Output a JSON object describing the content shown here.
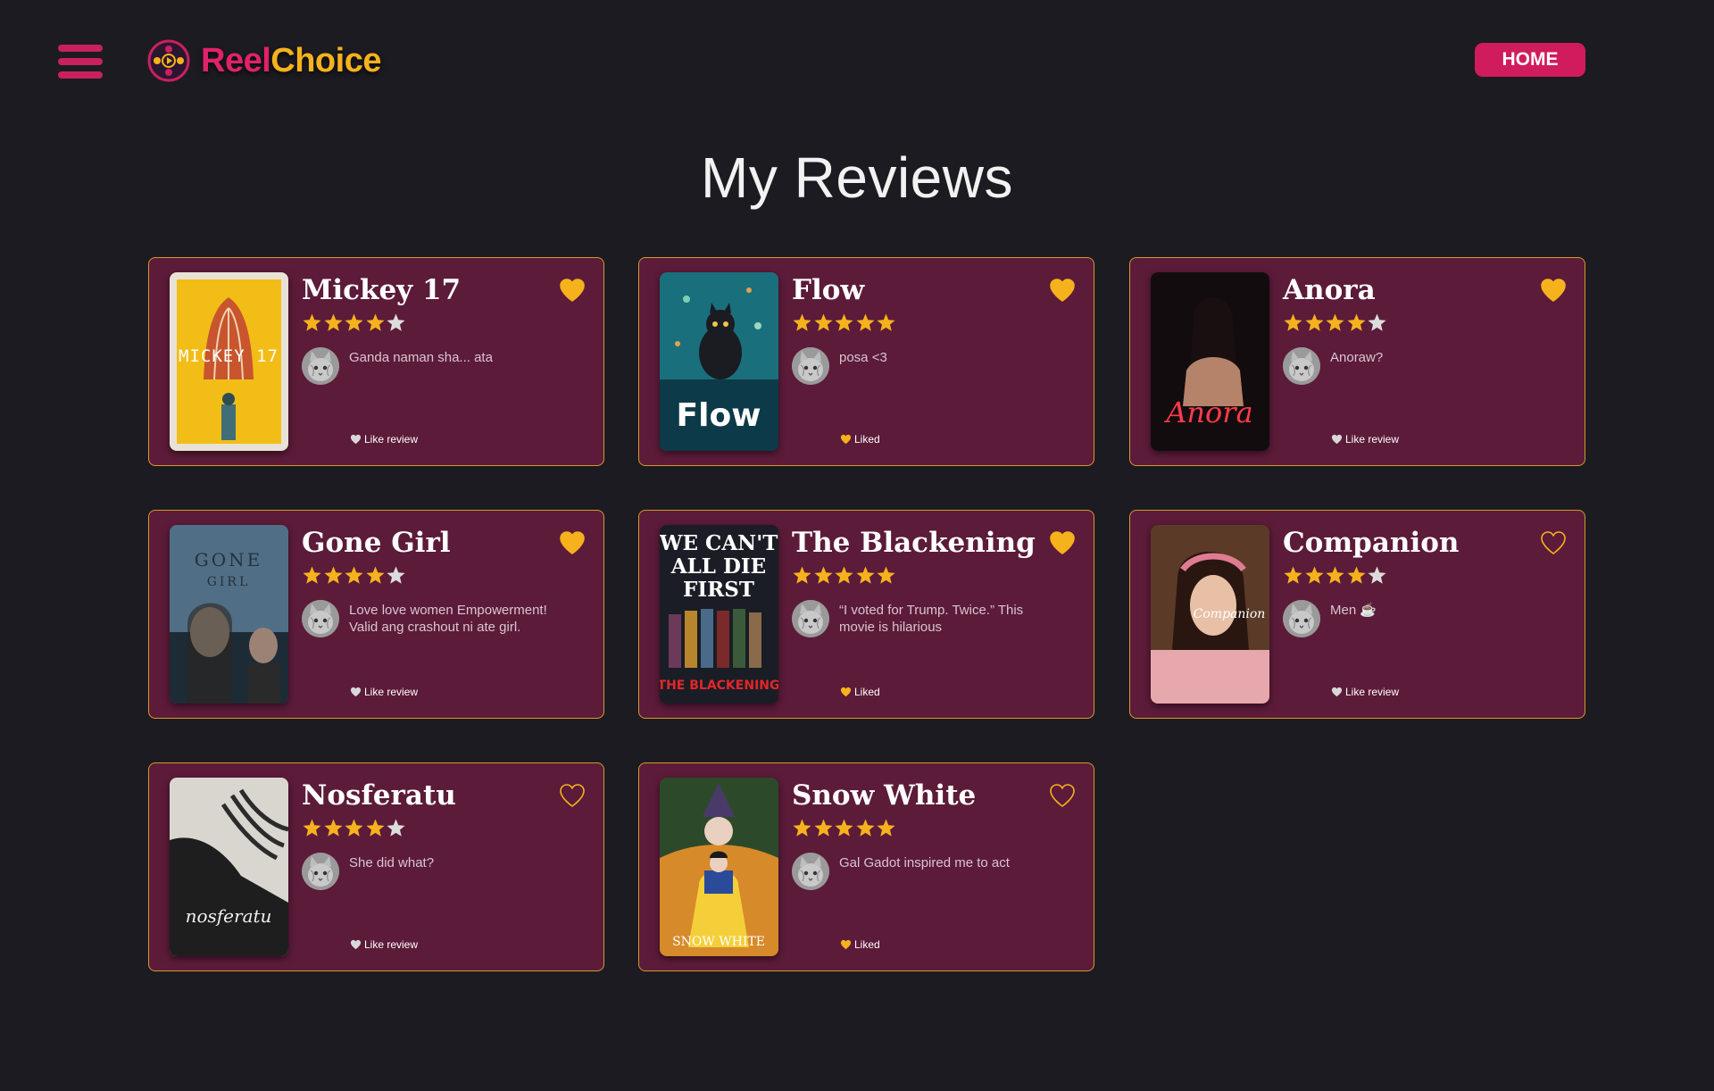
{
  "app": {
    "brand_part1": "Reel",
    "brand_part2": "Choice",
    "home_label": "HOME",
    "page_title": "My Reviews"
  },
  "colors": {
    "background": "#1c1b21",
    "card_bg": "#5c1b39",
    "card_border": "#d39a2a",
    "accent_pink": "#d01b5c",
    "accent_gold": "#f5b21d",
    "star_empty": "#dcdcdc"
  },
  "icons": {
    "menu": "hamburger-icon",
    "logo": "film-reel-icon",
    "favorite": "heart-icon",
    "rating": "star-icon"
  },
  "reviews": [
    {
      "title": "Mickey 17",
      "rating": 4,
      "text": "Ganda naman sha... ata",
      "like_label": "Like review",
      "liked": false,
      "favorite": true,
      "poster_text": "MICKEY 17"
    },
    {
      "title": "Flow",
      "rating": 5,
      "text": "posa <3",
      "like_label": "Liked",
      "liked": true,
      "favorite": true,
      "poster_text": "Flow"
    },
    {
      "title": "Anora",
      "rating": 4,
      "text": "Anoraw?",
      "like_label": "Like review",
      "liked": false,
      "favorite": true,
      "poster_text": "Anora"
    },
    {
      "title": "Gone Girl",
      "rating": 4,
      "text": "Love love women Empowerment! Valid ang crashout ni ate girl.",
      "like_label": "Like review",
      "liked": false,
      "favorite": true,
      "poster_text": "GONE GIRL"
    },
    {
      "title": "The Blackening",
      "rating": 5,
      "text": "“I voted for Trump. Twice.” This movie is hilarious",
      "like_label": "Liked",
      "liked": true,
      "favorite": true,
      "poster_text": "WE CAN'T ALL DIE FIRST"
    },
    {
      "title": "Companion",
      "rating": 4,
      "text": "Men ☕",
      "like_label": "Like review",
      "liked": false,
      "favorite": false,
      "poster_text": "Companion"
    },
    {
      "title": "Nosferatu",
      "rating": 4,
      "text": "She did what?",
      "like_label": "Like review",
      "liked": false,
      "favorite": false,
      "poster_text": "nosferatu"
    },
    {
      "title": "Snow White",
      "rating": 5,
      "text": "Gal Gadot inspired me to act",
      "like_label": "Liked",
      "liked": true,
      "favorite": false,
      "poster_text": "SNOW WHITE"
    }
  ]
}
